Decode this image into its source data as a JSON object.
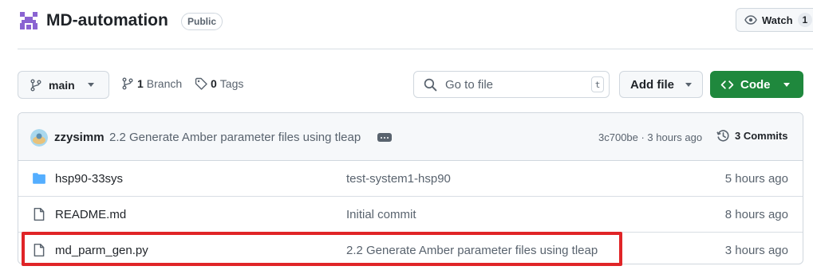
{
  "repo": {
    "name": "MD-automation",
    "visibility": "Public",
    "watch_label": "Watch",
    "watch_count": "1"
  },
  "toolbar": {
    "branch_name": "main",
    "branch_count": "1",
    "branch_label": "Branch",
    "tag_count": "0",
    "tag_label": "Tags",
    "goto_placeholder": "Go to file",
    "goto_shortcut": "t",
    "add_file_label": "Add file",
    "code_label": "Code"
  },
  "latest_commit": {
    "author": "zzysimm",
    "message": "2.2 Generate Amber parameter files using tleap",
    "meta": "3c700be · 3 hours ago",
    "commits_label": "3 Commits"
  },
  "files": [
    {
      "name": "hsp90-33sys",
      "type": "folder",
      "commit": "test-system1-hsp90",
      "time": "5 hours ago"
    },
    {
      "name": "README.md",
      "type": "file",
      "commit": "Initial commit",
      "time": "8 hours ago"
    },
    {
      "name": "md_parm_gen.py",
      "type": "file",
      "commit": "2.2 Generate Amber parameter files using tleap",
      "time": "3 hours ago"
    }
  ],
  "colors": {
    "accent_green": "#1f883d",
    "folder_blue": "#54aeff",
    "highlight_red": "#e02427"
  }
}
